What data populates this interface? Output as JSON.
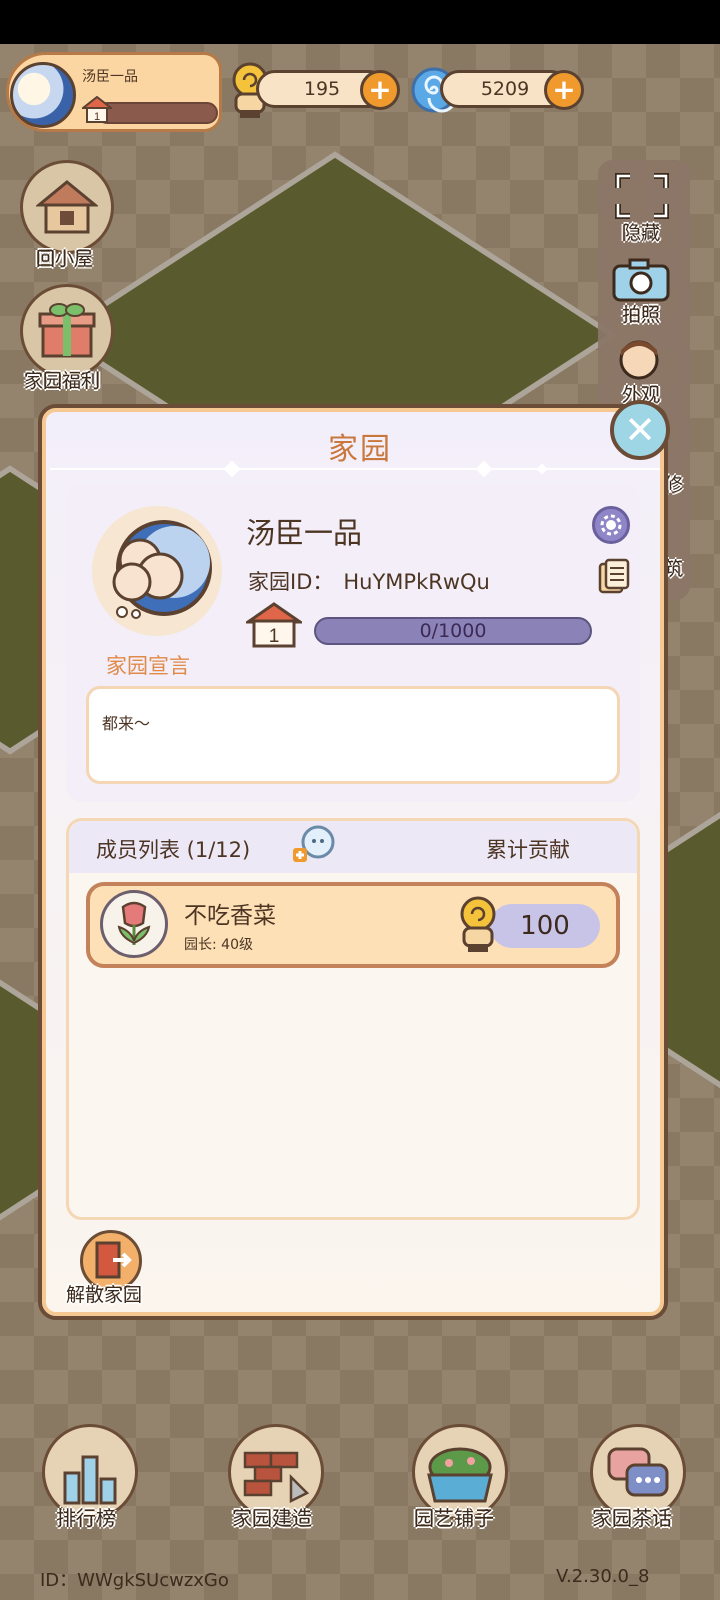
{
  "player": {
    "name": "汤臣一品",
    "level": "1"
  },
  "currency": {
    "snail": {
      "value": "195",
      "icon": "snail-coin-icon"
    },
    "swirl": {
      "value": "5209",
      "icon": "swirl-gem-icon"
    },
    "plus_label": "+"
  },
  "left_menu": [
    {
      "label": "回小屋",
      "icon": "house-icon"
    },
    {
      "label": "家园福利",
      "icon": "gift-box-icon"
    }
  ],
  "right_menu": [
    {
      "label": "隐藏",
      "icon": "fullscreen-icon"
    },
    {
      "label": "拍照",
      "icon": "camera-icon"
    },
    {
      "label": "外观",
      "icon": "character-icon"
    },
    {
      "label": "修",
      "icon": "wrench-icon"
    },
    {
      "label": "筑",
      "icon": "build-icon"
    }
  ],
  "modal": {
    "title": "家园",
    "close_label": "✕",
    "garden": {
      "name": "汤臣一品",
      "id_label": "家园ID：",
      "id_value": "HuYMPkRwQu",
      "level": "1",
      "progress_text": "0/1000",
      "progress_fraction": 0,
      "manifesto_label": "家园宣言",
      "manifesto_text": "都来～"
    },
    "members": {
      "title": "成员列表 (1/12)",
      "contribution_header": "累计贡献",
      "rows": [
        {
          "name": "不吃香菜",
          "role": "园长: 40级",
          "contribution": "100"
        }
      ]
    },
    "dissolve_label": "解散家园"
  },
  "bottom_nav": [
    {
      "label": "排行榜",
      "icon": "leaderboard-icon"
    },
    {
      "label": "家园建造",
      "icon": "bricks-trowel-icon"
    },
    {
      "label": "园艺铺子",
      "icon": "flower-basket-icon"
    },
    {
      "label": "家园茶话",
      "icon": "chat-bubbles-icon"
    }
  ],
  "footer": {
    "id": "ID：WWgkSUcwzxGo",
    "version": "V.2.30.0_8"
  },
  "colors": {
    "accent": "#c9773c",
    "progress": "#8b83b7",
    "plus": "#f09a2e",
    "lawn": "#6f7a3c"
  }
}
